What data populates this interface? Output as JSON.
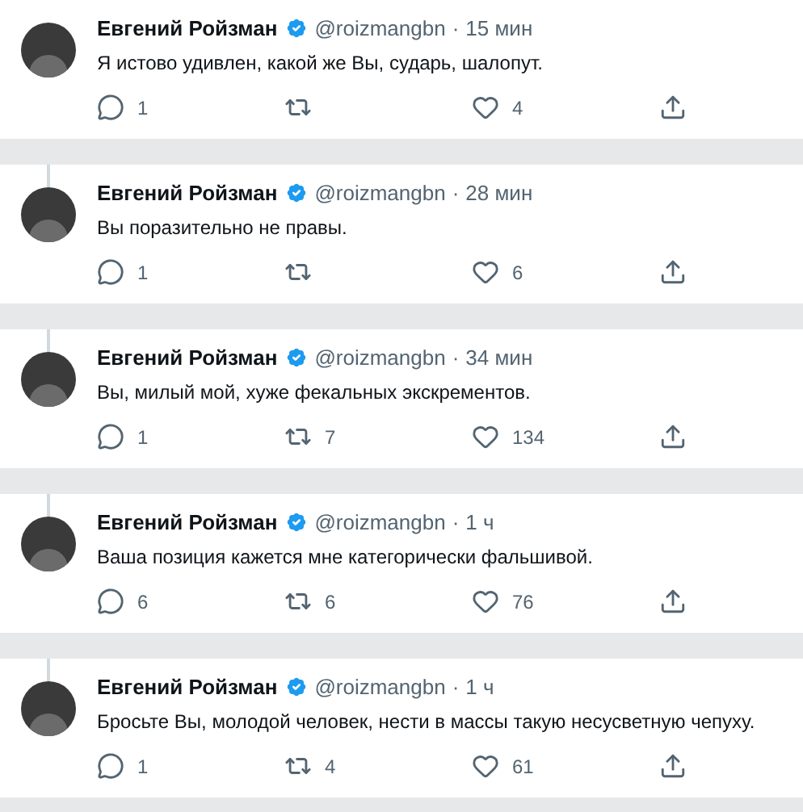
{
  "tweets": [
    {
      "name": "Евгений Ройзман",
      "handle": "@roizmangbn",
      "separator": "·",
      "time": "15 мин",
      "text": "Я истово удивлен, какой же Вы, сударь, шалопут.",
      "replies": "1",
      "likes": "4",
      "thread_line": false
    },
    {
      "name": "Евгений Ройзман",
      "handle": "@roizmangbn",
      "separator": "·",
      "time": "28 мин",
      "text": "Вы поразительно не правы.",
      "replies": "1",
      "likes": "6",
      "thread_line": true
    },
    {
      "name": "Евгений Ройзман",
      "handle": "@roizmangbn",
      "separator": "·",
      "time": "34 мин",
      "text": "Вы, милый мой, хуже фекальных экскрементов.",
      "replies": "1",
      "retweets": "7",
      "likes": "134",
      "thread_line": true
    },
    {
      "name": "Евгений Ройзман",
      "handle": "@roizmangbn",
      "separator": "·",
      "time": "1 ч",
      "text": "Ваша позиция кажется мне категорически фальшивой.",
      "replies": "6",
      "retweets": "6",
      "likes": "76",
      "thread_line": true
    },
    {
      "name": "Евгений Ройзман",
      "handle": "@roizmangbn",
      "separator": "·",
      "time": "1 ч",
      "text": "Бросьте Вы, молодой человек, нести в массы такую несусветную чепуху.",
      "replies": "1",
      "retweets": "4",
      "likes": "61",
      "thread_line": true
    }
  ]
}
